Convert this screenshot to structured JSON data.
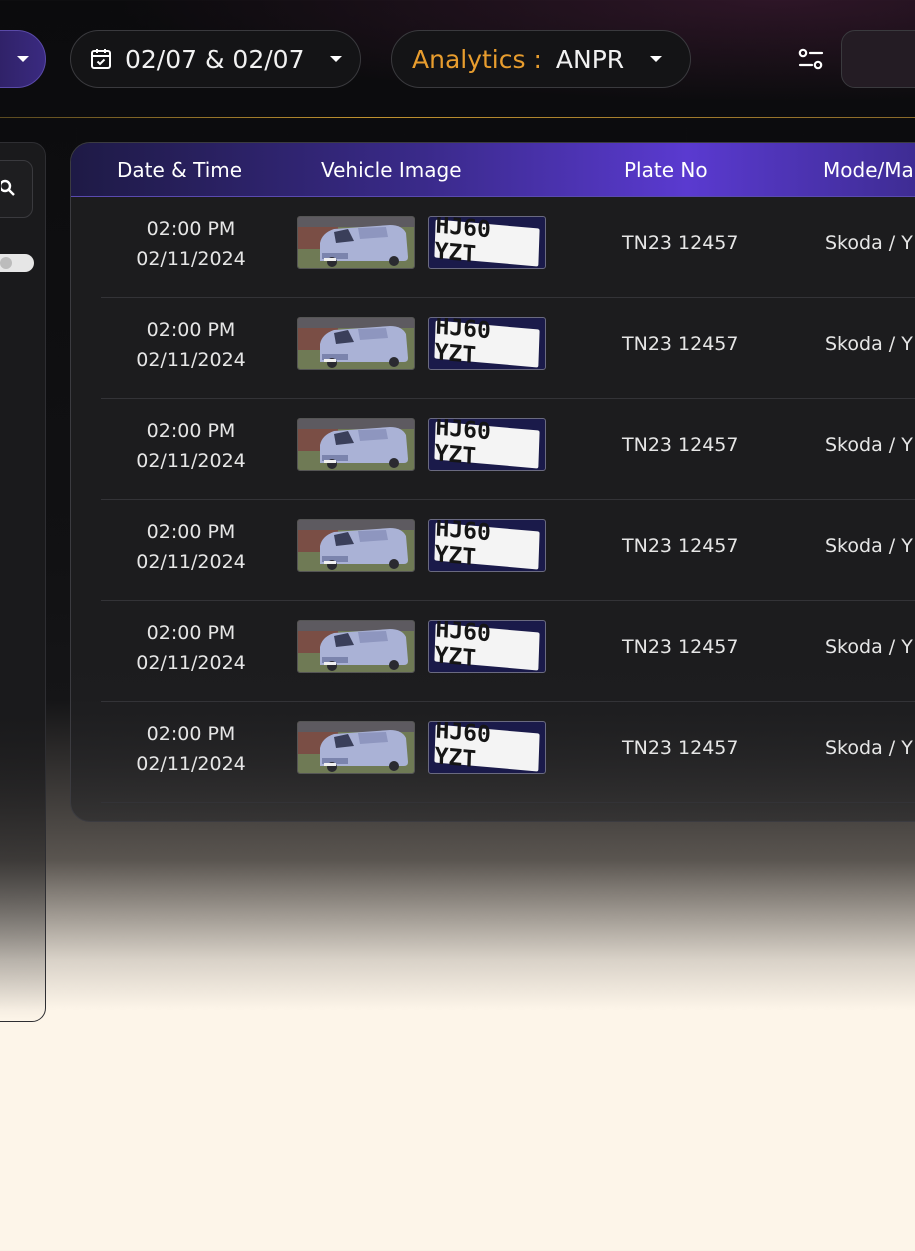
{
  "toolbar": {
    "date_range": "02/07 & 02/07",
    "analytics_label": "Analytics :",
    "analytics_value": "ANPR"
  },
  "table": {
    "columns": [
      "Date & Time",
      "Vehicle Image",
      "Plate No",
      "Mode/Ma"
    ],
    "rows": [
      {
        "time": "02:00 PM",
        "date": "02/11/2024",
        "plate_image_text": "HJ60 YZT",
        "plate_no": "TN23 12457",
        "mode": "Skoda / Y"
      },
      {
        "time": "02:00 PM",
        "date": "02/11/2024",
        "plate_image_text": "HJ60 YZT",
        "plate_no": "TN23 12457",
        "mode": "Skoda / Y"
      },
      {
        "time": "02:00 PM",
        "date": "02/11/2024",
        "plate_image_text": "HJ60 YZT",
        "plate_no": "TN23 12457",
        "mode": "Skoda / Y"
      },
      {
        "time": "02:00 PM",
        "date": "02/11/2024",
        "plate_image_text": "HJ60 YZT",
        "plate_no": "TN23 12457",
        "mode": "Skoda / Y"
      },
      {
        "time": "02:00 PM",
        "date": "02/11/2024",
        "plate_image_text": "HJ60 YZT",
        "plate_no": "TN23 12457",
        "mode": "Skoda / Y"
      },
      {
        "time": "02:00 PM",
        "date": "02/11/2024",
        "plate_image_text": "HJ60 YZT",
        "plate_no": "TN23 12457",
        "mode": "Skoda / Y"
      }
    ]
  },
  "colors": {
    "accent_orange": "#e89d2e",
    "header_purple": "#5a3ad0",
    "background_dark": "#111113",
    "background_cream": "#fdf5e9"
  },
  "icons": [
    "chevron-down-icon",
    "calendar-check-icon",
    "filter-sliders-icon",
    "search-icon",
    "car-photo",
    "license-plate-photo"
  ]
}
